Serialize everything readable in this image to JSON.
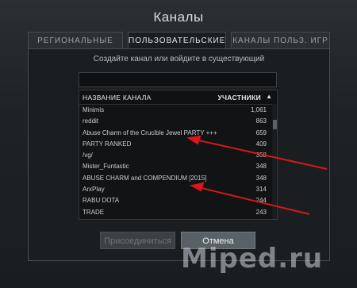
{
  "window": {
    "title": "Каналы"
  },
  "tabs": [
    {
      "label": "РЕГИОНАЛЬНЫЕ",
      "active": false
    },
    {
      "label": "ПОЛЬЗОВАТЕЛЬСКИЕ",
      "active": true
    },
    {
      "label": "КАНАЛЫ ПОЛЬЗ. ИГР",
      "active": false
    }
  ],
  "panel": {
    "subtitle": "Создайте канал или войдите в существующий",
    "search": {
      "value": "",
      "placeholder": ""
    }
  },
  "list": {
    "header": {
      "name": "НАЗВАНИЕ КАНАЛА",
      "users": "УЧАСТНИКИ",
      "sort_icon": "sort-arrow-up-icon"
    },
    "rows": [
      {
        "name": "Minimis",
        "count": "1,061"
      },
      {
        "name": "reddit",
        "count": "863"
      },
      {
        "name": "Abuse Charm of the Crucible Jewel PARTY +++",
        "count": "659"
      },
      {
        "name": "PARTY RANKED",
        "count": "409"
      },
      {
        "name": "/vg/",
        "count": "358"
      },
      {
        "name": "Mister_Funtastic",
        "count": "348"
      },
      {
        "name": "ABUSE CHARM and COMPENDIUM [2015]",
        "count": "348"
      },
      {
        "name": "ArxPlay",
        "count": "314"
      },
      {
        "name": "RABU DOTA",
        "count": "244"
      },
      {
        "name": "TRADE",
        "count": "243"
      }
    ]
  },
  "buttons": {
    "join": "Присоединиться",
    "cancel": "Отмена"
  },
  "watermark": {
    "text": "Miped.ru"
  },
  "colors": {
    "arrow": "#d8161c",
    "background": "#1e2226",
    "panel": "#1b1e21"
  }
}
